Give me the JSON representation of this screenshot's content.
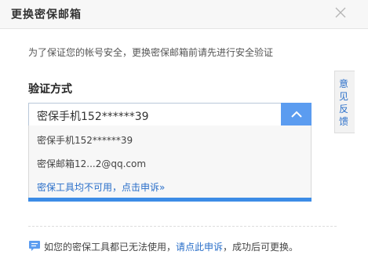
{
  "dialog": {
    "title": "更换密保邮箱",
    "description": "为了保证您的帐号安全，更换密保邮箱前请先进行安全验证"
  },
  "verify": {
    "label": "验证方式",
    "selected": "密保手机152******39",
    "options": [
      "密保手机152******39",
      "密保邮箱12...2@qq.com"
    ],
    "unavailable_link": "密保工具均不可用，点击申诉»"
  },
  "help": {
    "prefix": "如您的密保工具都已无法使用，",
    "link": "请点此申诉",
    "suffix": "，成功后可更换。"
  },
  "feedback": {
    "label": "意见反馈"
  },
  "icons": {
    "close": "close-icon",
    "arrow": "chevron-up-icon",
    "help": "chat-bubble-icon"
  },
  "colors": {
    "accent": "#5b9cf0",
    "link": "#2a6fc9",
    "bar": "#3c8ce6"
  }
}
